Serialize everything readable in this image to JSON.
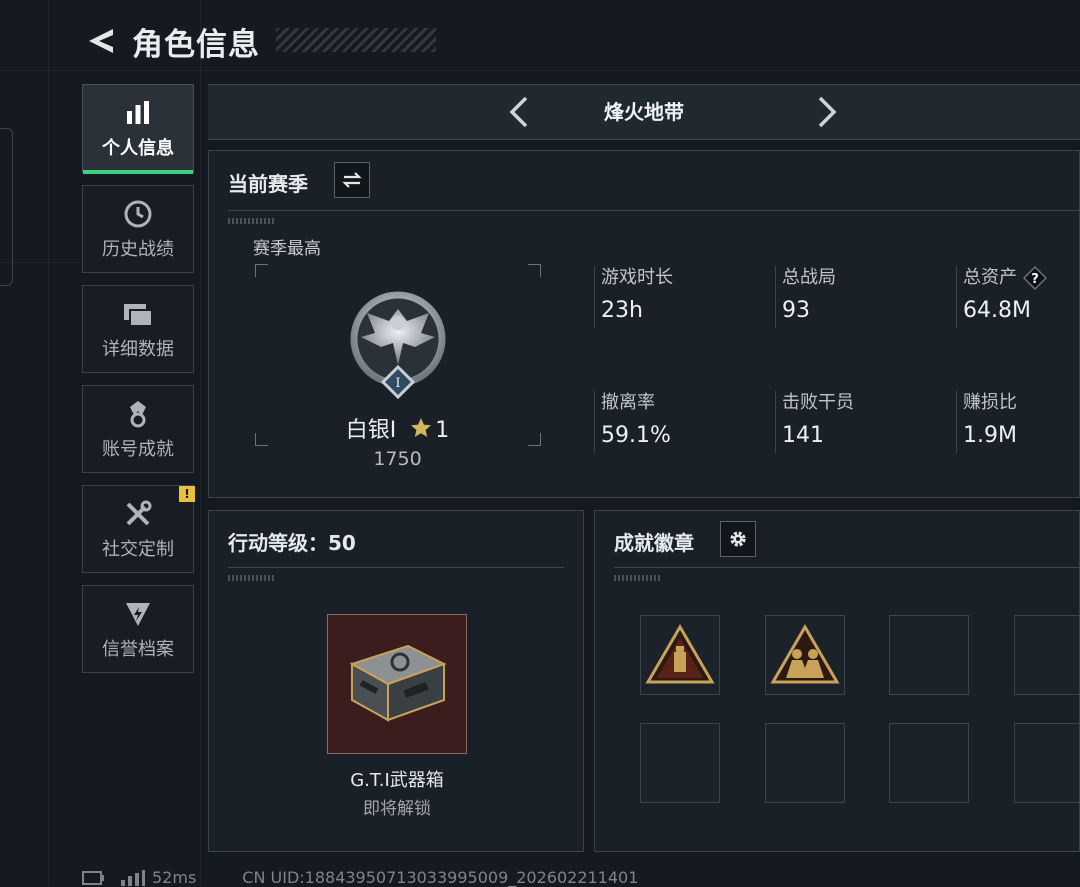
{
  "header": {
    "title": "角色信息"
  },
  "sidebar": {
    "items": [
      {
        "label": "个人信息",
        "icon": "bar-chart-icon",
        "active": true
      },
      {
        "label": "历史战绩",
        "icon": "history-clock-icon"
      },
      {
        "label": "详细数据",
        "icon": "folder-icon"
      },
      {
        "label": "账号成就",
        "icon": "achievement-medal-icon"
      },
      {
        "label": "社交定制",
        "icon": "tools-icon",
        "badge": "!"
      },
      {
        "label": "信誉档案",
        "icon": "credit-shield-icon"
      }
    ]
  },
  "mode": {
    "name": "烽火地带"
  },
  "season": {
    "title": "当前赛季",
    "best_label": "赛季最高",
    "rank_name": "白银I",
    "rank_stars": "1",
    "rank_score": "1750",
    "rank_emblem_numeral": "I"
  },
  "stats": [
    {
      "label": "游戏时长",
      "value": "23h"
    },
    {
      "label": "总战局",
      "value": "93"
    },
    {
      "label": "总资产",
      "value": "64.8M",
      "help": "?"
    },
    {
      "label": "撤离率",
      "value": "59.1%"
    },
    {
      "label": "击败干员",
      "value": "141"
    },
    {
      "label": "赚损比",
      "value": "1.9M"
    }
  ],
  "action_level": {
    "title": "行动等级：50",
    "reward_name": "G.T.I武器箱",
    "reward_status": "即将解锁"
  },
  "badges": {
    "title": "成就徽章",
    "slots": [
      {
        "filled": true,
        "icon": "triangle-usb-badge-icon"
      },
      {
        "filled": true,
        "icon": "triangle-squad-badge-icon"
      },
      {
        "filled": false
      },
      {
        "filled": false
      },
      {
        "filled": false
      },
      {
        "filled": false
      },
      {
        "filled": false
      },
      {
        "filled": false
      }
    ]
  },
  "footer": {
    "ping": "52ms",
    "uid": "CN UID:18843950713033995009_202602211401"
  },
  "colors": {
    "accent": "#3fd07d",
    "warning": "#e8c23a",
    "gold": "#c9a25a",
    "item_bg": "#3a1d1c"
  }
}
